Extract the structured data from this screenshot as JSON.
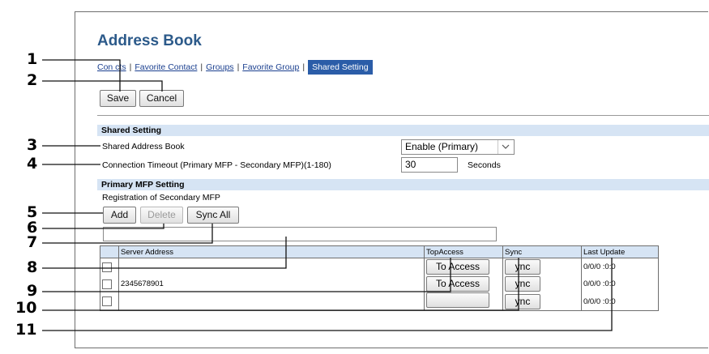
{
  "page": {
    "title": "Address Book"
  },
  "tabs": [
    {
      "label": "Con cts",
      "active": false
    },
    {
      "label": "Favorite Contact",
      "active": false
    },
    {
      "label": "Groups",
      "active": false
    },
    {
      "label": "Favorite Group",
      "active": false
    },
    {
      "label": "Shared Setting",
      "active": true
    }
  ],
  "tab_separator": "|",
  "actions": {
    "save_label": "Save",
    "cancel_label": "Cancel"
  },
  "shared_setting": {
    "header": "Shared Setting",
    "address_book_label": "Shared Address Book",
    "address_book_value": "Enable (Primary)",
    "timeout_label": "Connection Timeout (Primary MFP - Secondary MFP)(1-180)",
    "timeout_value": "30",
    "timeout_unit": "Seconds"
  },
  "primary_mfp": {
    "header": "Primary MFP Setting",
    "registration_label": "Registration of Secondary MFP",
    "add_label": "Add",
    "delete_label": "Delete",
    "sync_all_label": "Sync All",
    "entry_value": ""
  },
  "table": {
    "columns": [
      "Server Address",
      "TopAccess",
      "Sync",
      "Last Update"
    ],
    "rows": [
      {
        "address": "",
        "topaccess": "To Access",
        "sync": "ync",
        "last_update": "0/0/0 :0:0"
      },
      {
        "address": "2345678901",
        "topaccess": "To Access",
        "sync": "ync",
        "last_update": "0/0/0 :0:0"
      },
      {
        "address": "",
        "topaccess": "",
        "sync": "ync",
        "last_update": "0/0/0 :0:0"
      }
    ]
  },
  "callouts": [
    "1",
    "2",
    "3",
    "4",
    "5",
    "6",
    "7",
    "8",
    "9",
    "10",
    "11"
  ],
  "colors": {
    "title": "#2c5a8a",
    "section_bar": "#d6e4f4",
    "active_tab": "#2b5da8"
  }
}
